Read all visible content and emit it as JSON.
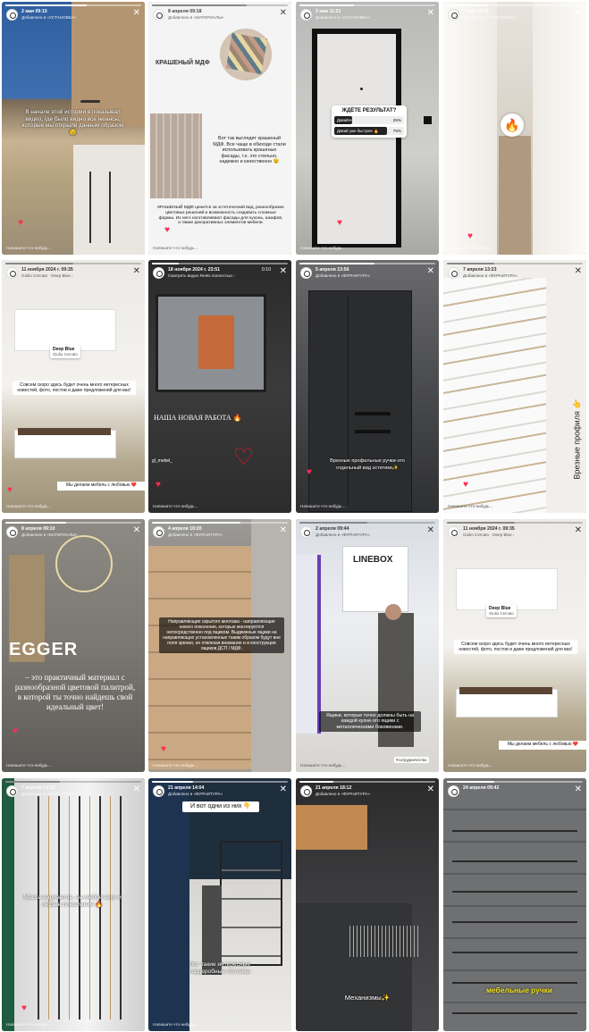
{
  "stories": [
    {
      "date": "2 мая",
      "time": "09:15",
      "sub": "Добавлено в «УСТАНОВКА»",
      "caption": "В начале этой истории я показывал видео, где было видно все нюансы, которые мы открыли данным образом 😉",
      "reply": "Напишите что-нибудь..."
    },
    {
      "date": "8 апреля",
      "time": "09:18",
      "sub": "Добавлено в «МАТЕРИАЛЫ»",
      "title": "КРАШЕНЫЙ МДФ",
      "caption": "Вот так выглядит крашеный МДФ. Все чаще в обиходе стали использовать крашеные фасады, т.к. это стильно, надежно и качественно 😉",
      "caption2": "КРАШЕНЫЙ МДФ ценится за эстетический вид, разнообразие цветовых решений и возможность создавать сложные формы. Из него изготавливают фасады для кухонь, шкафов, а также декоративных элементов мебели.",
      "reply": "Напишите что-нибудь..."
    },
    {
      "date": "3 мая",
      "time": "11:21",
      "sub": "Добавлено в «УСТАНОВКА»",
      "poll_title": "ЖДЁТЕ РЕЗУЛЬТАТ?",
      "poll": [
        {
          "label": "Давайте",
          "pct": "25%"
        },
        {
          "label": "Давай уже быстрее 🔥",
          "pct": "75%"
        }
      ],
      "reply": "Напишите что-нибудь..."
    },
    {
      "date": "7 мая",
      "time": "16:31",
      "sub": "Добавлено в «УСТАНОВКА»",
      "reply": "Напишите что-нибудь..."
    },
    {
      "date": "11 ноября 2024 г.",
      "time": "09:35",
      "sub": "Giulio Cercato · Deep Blue ›",
      "tag_title": "Deep Blue",
      "tag_sub": "Giulio Cercato",
      "caption": "Совсем скоро здесь будет очень много интересных новостей, фото, постов и даже предложений для вас!",
      "caption2": "Мы делаем мебель с любовью ❤️",
      "reply": "Напишите что-нибудь..."
    },
    {
      "date": "18 ноября 2024 г.",
      "time": "23:51",
      "sub": "Смотреть видео Reels полностью ›",
      "timer": "0:10",
      "caption": "НАША НОВАЯ РАБОТА 🔥",
      "tag": "gl_mebel_",
      "reply": "Напишите что-нибудь..."
    },
    {
      "date": "5 апреля",
      "time": "13:56",
      "sub": "Добавлено в «ФУРНИТУРА»",
      "caption": "Врезные профильные ручки-это отдельный вид эстетики✨",
      "reply": "Напишите что-нибудь..."
    },
    {
      "date": "7 апреля",
      "time": "13:23",
      "sub": "Добавлено в «ФУРНИТУРА»",
      "vertical": "Врезные профиля 👉",
      "reply": "Напишите что-нибудь..."
    },
    {
      "date": "8 апреля",
      "time": "09:10",
      "sub": "Добавлено в «МАТЕРИАЛЫ»",
      "brand": "EGGER",
      "caption": "– это практичный материал с разнообразной цветовой палитрой, в которой ты точно найдешь свой идеальный цвет!",
      "reply": "Напишите что-нибудь..."
    },
    {
      "date": "4 апреля",
      "time": "10:20",
      "sub": "Добавлено в «ФУРНИТУРА»",
      "caption": "Направляющие скрытого монтажа - направляющие нового поколения, которые монтируются непосредственно под ящиком. Выдвижные ящики на направляющих установленные таким образом будут вне поля зрения, не отвлекая внимание и в конструкции ящиков ДСП / МДФ.",
      "reply": "Напишите что-нибудь..."
    },
    {
      "date": "2 апреля",
      "time": "09:44",
      "sub": "Добавлено в «ФУРНИТУРА»",
      "sign": "LINEBOX",
      "caption": "Ящики, которые точно должны быть на каждой кухне-это ящики с металлическими боковинами.",
      "badge": "#сотрудничество",
      "reply": "Напишите что-нибудь..."
    },
    {
      "date": "11 ноября 2024 г.",
      "time": "09:35",
      "sub": "Giulio Cercato · Deep Blue ›",
      "tag_title": "Deep Blue",
      "tag_sub": "Giulio Cercato",
      "caption": "Совсем скоро здесь будет очень много интересных новостей, фото, постов и даже предложений для вас!",
      "caption2": "Мы делаем мебель с любовью ❤️",
      "reply": "Напишите что-нибудь..."
    },
    {
      "date": "7 апреля",
      "time": "13:23",
      "sub": "Добавлено в «ФУРНИТУРА»",
      "caption": "Масса вариантов, на любой вкус и любые пожелания 🔥",
      "reply": "Напишите что-нибудь..."
    },
    {
      "date": "21 апреля",
      "time": "14:04",
      "sub": "Добавлено в «ФУРНИТУРА»",
      "caption_top": "И вот одни из них 👇",
      "caption": "Вот такие интересные гардеробные системы",
      "reply": "Напишите что-нибудь..."
    },
    {
      "date": "21 апреля",
      "time": "18:12",
      "sub": "Добавлено в «ФУРНИТУРА»",
      "caption": "Механизмы✨",
      "reply": "Напишите что-нибудь..."
    },
    {
      "date": "24 апреля",
      "time": "09:42",
      "sub": "",
      "caption": "мебельные ручки",
      "reply": "Напишите что-нибудь..."
    }
  ],
  "colors": {
    "accent_heart": "#ff2d55",
    "yellow_caption": "#f5e51b",
    "poll_bg": "#ffffff"
  }
}
